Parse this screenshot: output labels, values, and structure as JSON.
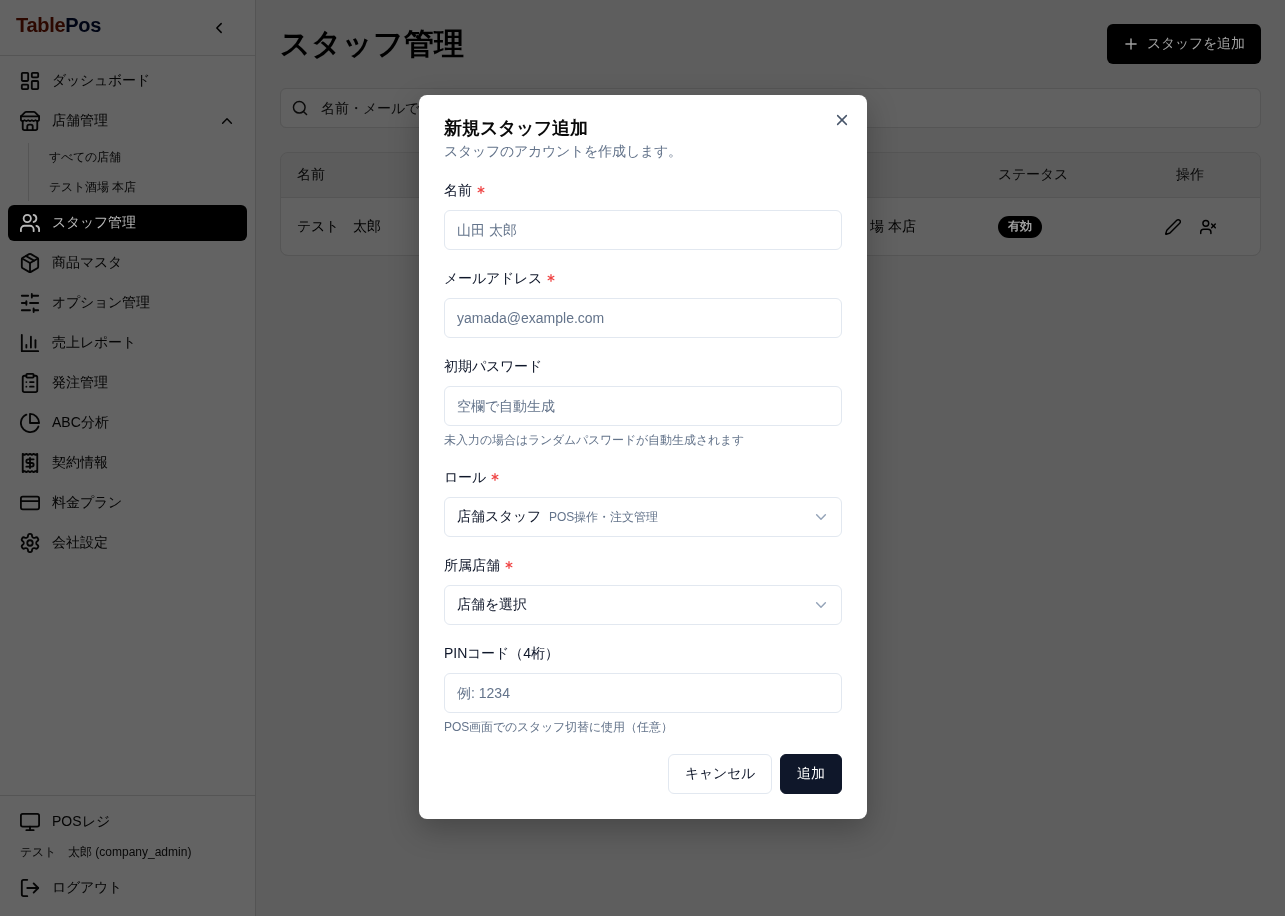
{
  "sidebar": {
    "logo": [
      "Table",
      "Pos"
    ],
    "items": [
      {
        "label": "ダッシュボード",
        "selected": false
      },
      {
        "label": "店舗管理",
        "selected": false,
        "expanded": true,
        "children": [
          {
            "label": "すべての店舗",
            "selected": false
          },
          {
            "label": "テスト酒場 本店",
            "selected": false
          }
        ]
      },
      {
        "label": "スタッフ管理",
        "selected": true
      },
      {
        "label": "商品マスタ",
        "selected": false
      },
      {
        "label": "オプション管理",
        "selected": false
      },
      {
        "label": "売上レポート",
        "selected": false
      },
      {
        "label": "発注管理",
        "selected": false
      },
      {
        "label": "ABC分析",
        "selected": false
      },
      {
        "label": "契約情報",
        "selected": false
      },
      {
        "label": "料金プラン",
        "selected": false
      },
      {
        "label": "会社設定",
        "selected": false
      }
    ],
    "footer": {
      "pos_link": "POSレジ",
      "user": "テスト　太郎 (company_admin)",
      "logout": "ログアウト"
    }
  },
  "page": {
    "title": "スタッフ管理",
    "add_button": "スタッフを追加",
    "search": {
      "placeholder": "名前・メールで"
    },
    "table": {
      "columns": [
        "名前",
        "ステータス",
        "操作"
      ],
      "rows": [
        {
          "name": "テスト　太郎",
          "column_2": "場 本店",
          "status": "有効"
        }
      ]
    }
  },
  "modal": {
    "title": "新規スタッフ追加",
    "description": "スタッフのアカウントを作成します。",
    "fields": [
      {
        "kind": "text",
        "label": "名前",
        "required": true,
        "placeholder": "山田 太郎"
      },
      {
        "kind": "text",
        "label": "メールアドレス",
        "required": true,
        "placeholder": "yamada@example.com"
      },
      {
        "kind": "text",
        "label": "初期パスワード",
        "required": false,
        "placeholder": "空欄で自動生成",
        "hint": "未入力の場合はランダムパスワードが自動生成されます"
      },
      {
        "kind": "select",
        "label": "ロール",
        "required": true,
        "value": "店舗スタッフ",
        "description": "POS操作・注文管理"
      },
      {
        "kind": "select",
        "label": "所属店舗",
        "required": true,
        "value": "店舗を選択"
      },
      {
        "kind": "text",
        "label": "PINコード（4桁）",
        "required": false,
        "placeholder": "例: 1234",
        "hint": "POS画面でのスタッフ切替に使用（任意）"
      }
    ],
    "buttons": [
      {
        "label": "キャンセル",
        "kind": "secondary"
      },
      {
        "label": "追加",
        "kind": "primary"
      }
    ]
  }
}
